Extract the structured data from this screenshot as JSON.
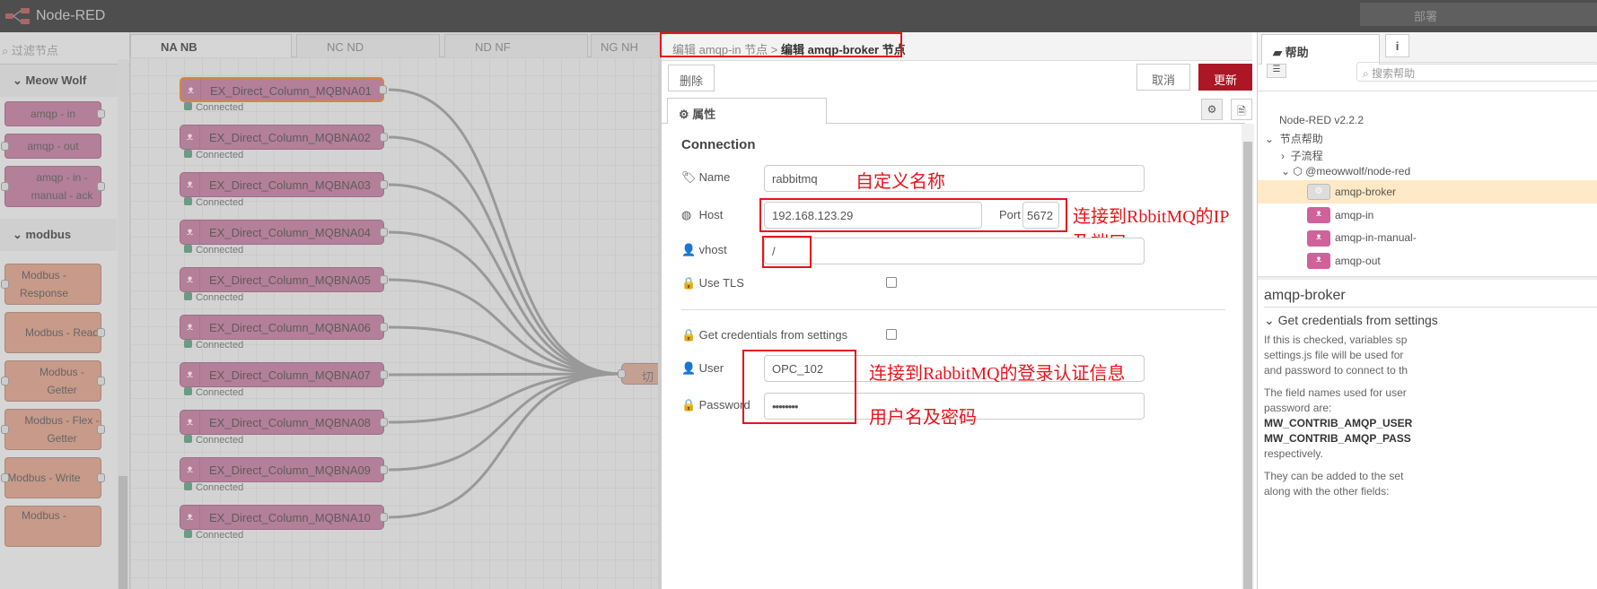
{
  "header": {
    "title": "Node-RED",
    "deploy_label": "部署"
  },
  "palette": {
    "filter_placeholder": "过滤节点",
    "categories": [
      {
        "label": "Meow Wolf"
      },
      {
        "label": "modbus"
      }
    ],
    "nodes": [
      "amqp - in",
      "amqp - out",
      "amqp - in - manual - ack",
      "Modbus - Response",
      "Modbus - Read",
      "Modbus - Getter",
      "Modbus - Flex - Getter",
      "Modbus - Write",
      "Modbus -"
    ]
  },
  "workspace_tabs": [
    "NA NB",
    "NC ND",
    "ND NF",
    "NG NH"
  ],
  "canvas": {
    "nodes": [
      "EX_Direct_Column_MQBNA01",
      "EX_Direct_Column_MQBNA02",
      "EX_Direct_Column_MQBNA03",
      "EX_Direct_Column_MQBNA04",
      "EX_Direct_Column_MQBNA05",
      "EX_Direct_Column_MQBNA06",
      "EX_Direct_Column_MQBNA07",
      "EX_Direct_Column_MQBNA08",
      "EX_Direct_Column_MQBNA09",
      "EX_Direct_Column_MQBNA10"
    ],
    "status": "Connected",
    "target_node": "切"
  },
  "editor": {
    "breadcrumb_parent": "编辑 amqp-in 节点 >",
    "breadcrumb_current": "编辑 amqp-broker 节点",
    "delete": "删除",
    "cancel": "取消",
    "update": "更新",
    "tab_properties": "属性",
    "section": "Connection",
    "name_label": "Name",
    "name_value": "rabbitmq",
    "host_label": "Host",
    "host_value": "192.168.123.29",
    "port_label": "Port",
    "port_value": "5672",
    "vhost_label": "vhost",
    "vhost_value": "/",
    "tls_label": "Use TLS",
    "tls_checked": false,
    "cred_label": "Get credentials from settings",
    "cred_checked": false,
    "user_label": "User",
    "user_value": "OPC_102",
    "password_label": "Password",
    "password_value": "••••••••",
    "annotations": {
      "name": "自定义名称",
      "host": "连接到RbbitMQ的IP及端口",
      "user": "连接到RabbitMQ的登录认证信息",
      "password": "用户名及密码"
    },
    "annotation_color": "#e8141b"
  },
  "sidebar": {
    "help_tab": "帮助",
    "info_tab": "i",
    "search_placeholder": "搜索帮助",
    "tree": {
      "version": "Node-RED v2.2.2",
      "node_help": "节点帮助",
      "subflow": "子流程",
      "package": "@meowwolf/node-red",
      "items": [
        "amqp-broker",
        "amqp-in",
        "amqp-in-manual-",
        "amqp-out"
      ]
    },
    "help": {
      "title": "amqp-broker",
      "section": "Get credentials from settings",
      "p1": [
        "If this is checked, variables sp",
        "settings.js file will be used for",
        "and password to connect to th"
      ],
      "p2": [
        "The field names used for user",
        "password are:"
      ],
      "fields": [
        "MW_CONTRIB_AMQP_USER",
        "MW_CONTRIB_AMQP_PASS"
      ],
      "p2_end": "respectively.",
      "p3": [
        "They can be added to the set",
        "along with the other fields:"
      ]
    }
  }
}
